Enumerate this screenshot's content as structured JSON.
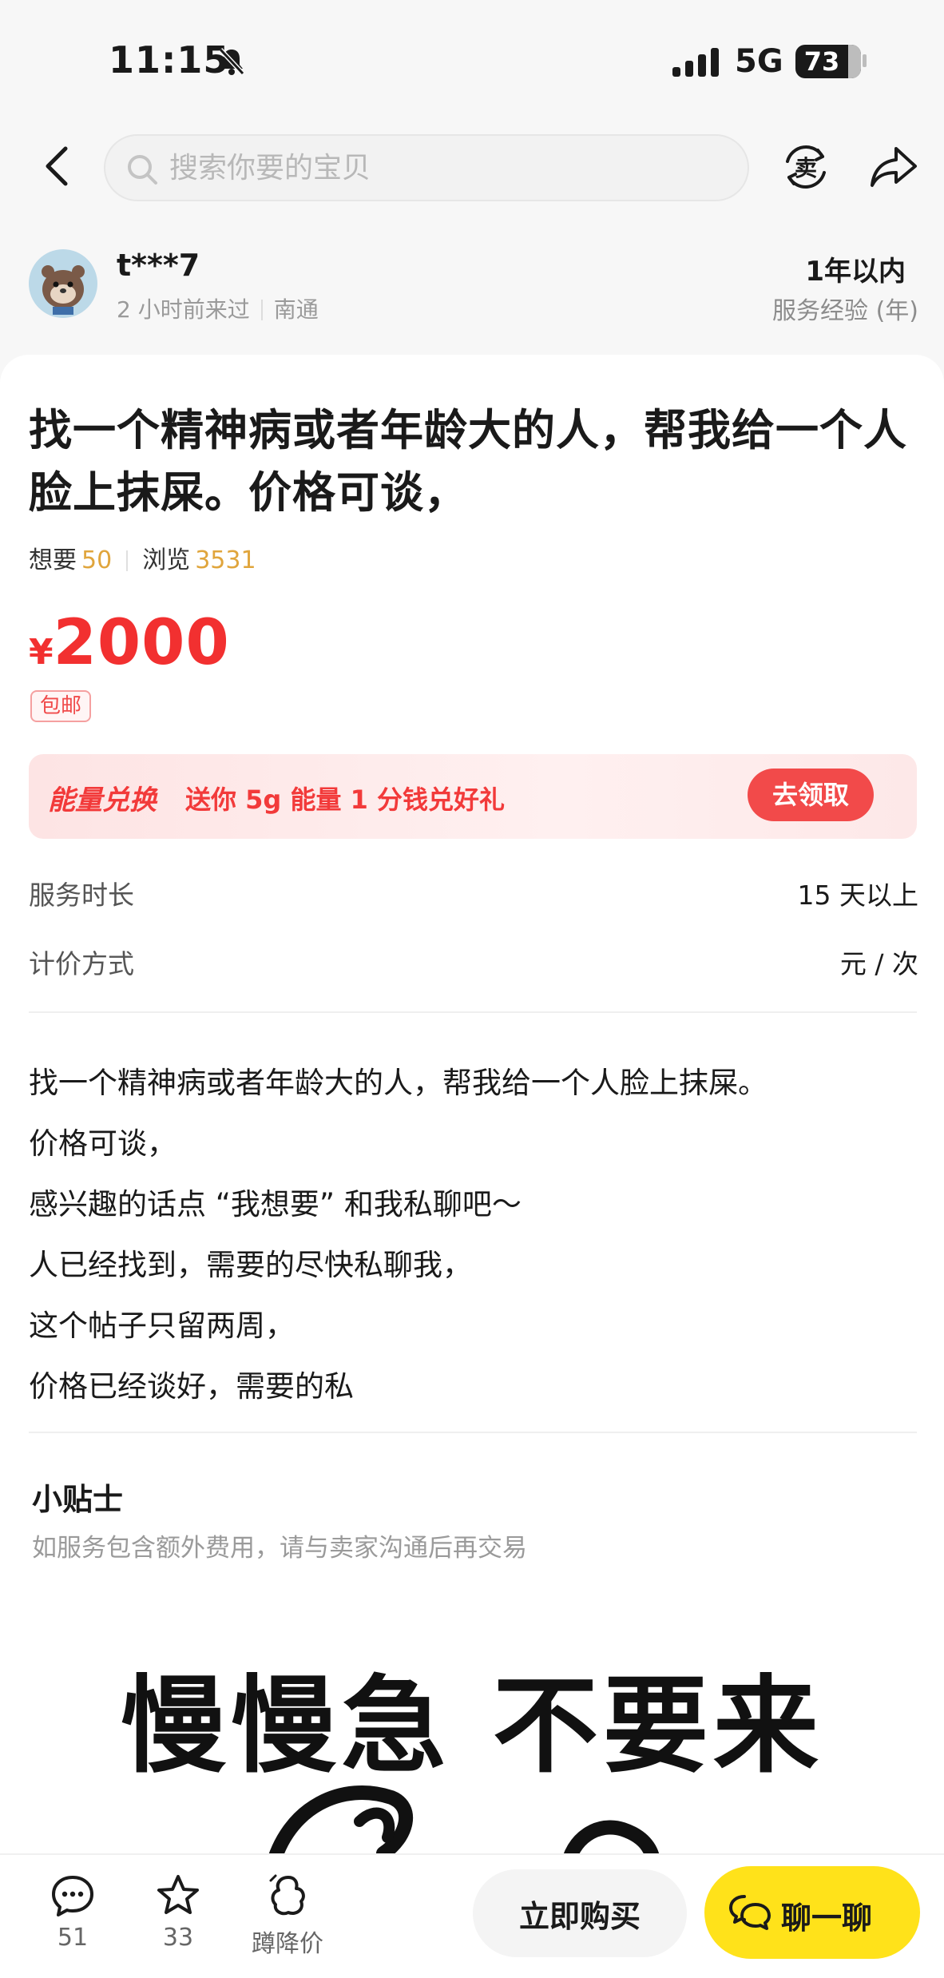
{
  "status_bar": {
    "time": "11:15",
    "network": "5G",
    "battery": "73"
  },
  "header": {
    "search_placeholder": "搜索你要的宝贝",
    "sell_glyph": "卖"
  },
  "seller": {
    "name": "t***7",
    "last_seen": "2 小时前来过",
    "location": "南通",
    "experience_value": "1年以内",
    "experience_label": "服务经验 (年)"
  },
  "item": {
    "title": "找一个精神病或者年龄大的人，帮我给一个人脸上抹屎。价格可谈，",
    "want_label": "想要",
    "want_count": "50",
    "view_label": "浏览",
    "view_count": "3531",
    "price_symbol": "¥",
    "price": "2000",
    "shipping_tag": "包邮"
  },
  "promo": {
    "brand": "能量兑换",
    "text": "送你 5g 能量 1 分钱兑好礼",
    "button": "去领取"
  },
  "attributes": [
    {
      "label": "服务时长",
      "value": "15 天以上"
    },
    {
      "label": "计价方式",
      "value": "元 / 次"
    }
  ],
  "description": [
    "找一个精神病或者年龄大的人，帮我给一个人脸上抹屎。",
    "价格可谈，",
    "感兴趣的话点 “我想要” 和我私聊吧～",
    "人已经找到，需要的尽快私聊我，",
    "这个帖子只留两周，",
    "价格已经谈好，需要的私"
  ],
  "tips": {
    "title": "小贴士",
    "text": "如服务包含额外费用，请与卖家沟通后再交易"
  },
  "image_caption": "慢慢急 不要来",
  "bottom_bar": {
    "comments": "51",
    "favorites": "33",
    "price_drop": "蹲降价",
    "buy": "立即购买",
    "chat": "聊一聊"
  },
  "colors": {
    "price_red": "#f23030",
    "stat_orange": "#e0a53c",
    "chat_yellow": "#ffe21a"
  },
  "icons": [
    "bell-off-icon",
    "signal-icon",
    "battery-icon",
    "back-icon",
    "search-icon",
    "sell-icon",
    "share-icon",
    "comment-icon",
    "star-icon",
    "price-drop-icon",
    "chat-icon"
  ]
}
